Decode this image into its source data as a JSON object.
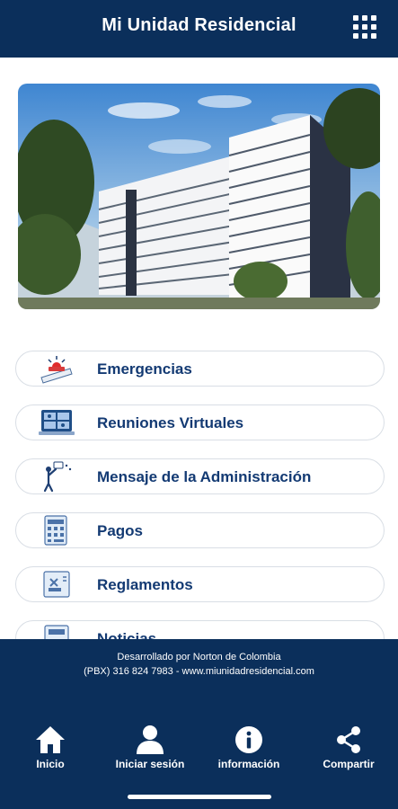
{
  "header": {
    "title": "Mi Unidad Residencial",
    "menu_icon": "grid-menu-icon"
  },
  "hero": {
    "alt": "building photo"
  },
  "menu": {
    "items": [
      {
        "label": "Emergencias",
        "icon": "emergency-icon"
      },
      {
        "label": "Reuniones Virtuales",
        "icon": "video-meeting-icon"
      },
      {
        "label": "Mensaje de la Administración",
        "icon": "announcement-icon"
      },
      {
        "label": "Pagos",
        "icon": "payments-icon"
      },
      {
        "label": "Reglamentos",
        "icon": "rules-icon"
      },
      {
        "label": "Noticias",
        "icon": "news-icon"
      }
    ]
  },
  "footer": {
    "line1": "Desarrollado por Norton de Colombia",
    "line2": "(PBX) 316 824 7983 - www.miunidadresidencial.com"
  },
  "nav": {
    "items": [
      {
        "label": "Inicio",
        "icon": "home-icon"
      },
      {
        "label": "Iniciar sesión",
        "icon": "user-icon"
      },
      {
        "label": "información",
        "icon": "info-icon"
      },
      {
        "label": "Compartir",
        "icon": "share-icon"
      }
    ]
  },
  "colors": {
    "primary": "#0b2f5b",
    "accent": "#133a73"
  }
}
